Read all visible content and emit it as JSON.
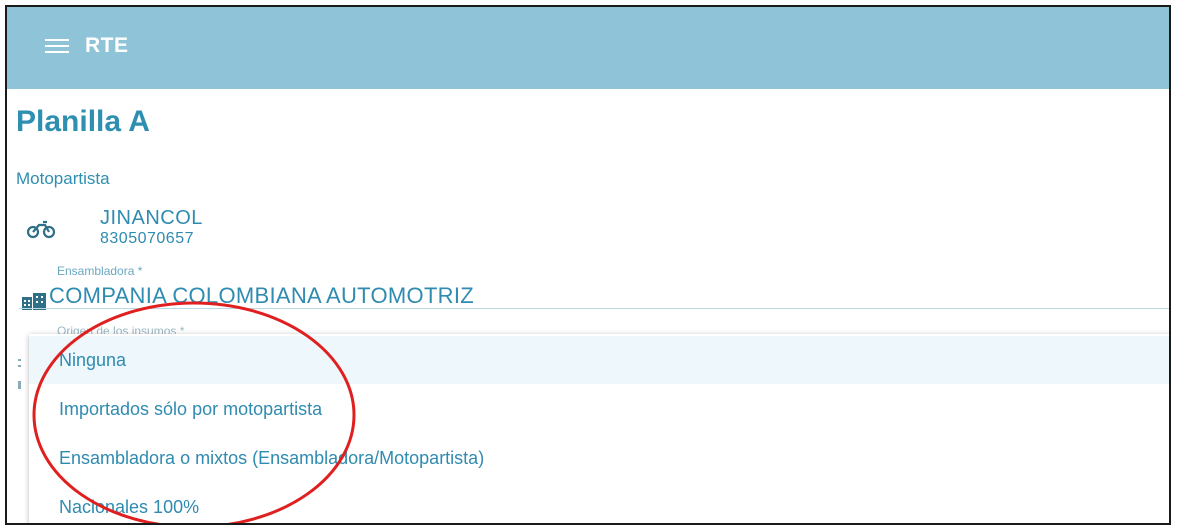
{
  "app": {
    "title": "RTE"
  },
  "page": {
    "title": "Planilla A"
  },
  "motopartista": {
    "section_label": "Motopartista",
    "name": "JINANCOL",
    "id": "8305070657"
  },
  "ensambladora": {
    "label": "Ensambladora *",
    "value": "COMPANIA COLOMBIANA AUTOMOTRIZ"
  },
  "origen": {
    "label": "Origen de los insumos *",
    "options": [
      {
        "label": "Ninguna",
        "selected": true
      },
      {
        "label": "Importados sólo por motopartista",
        "selected": false
      },
      {
        "label": "Ensambladora o mixtos (Ensambladora/Motopartista)",
        "selected": false
      },
      {
        "label": "Nacionales 100%",
        "selected": false
      }
    ]
  },
  "colors": {
    "appbar": "#8fc4d8",
    "accent": "#2e8fb0",
    "annotation": "#e02020"
  },
  "icons": {
    "menu": "menu-icon",
    "motopartista": "motorcycle-icon",
    "ensambladora": "building-icon"
  }
}
